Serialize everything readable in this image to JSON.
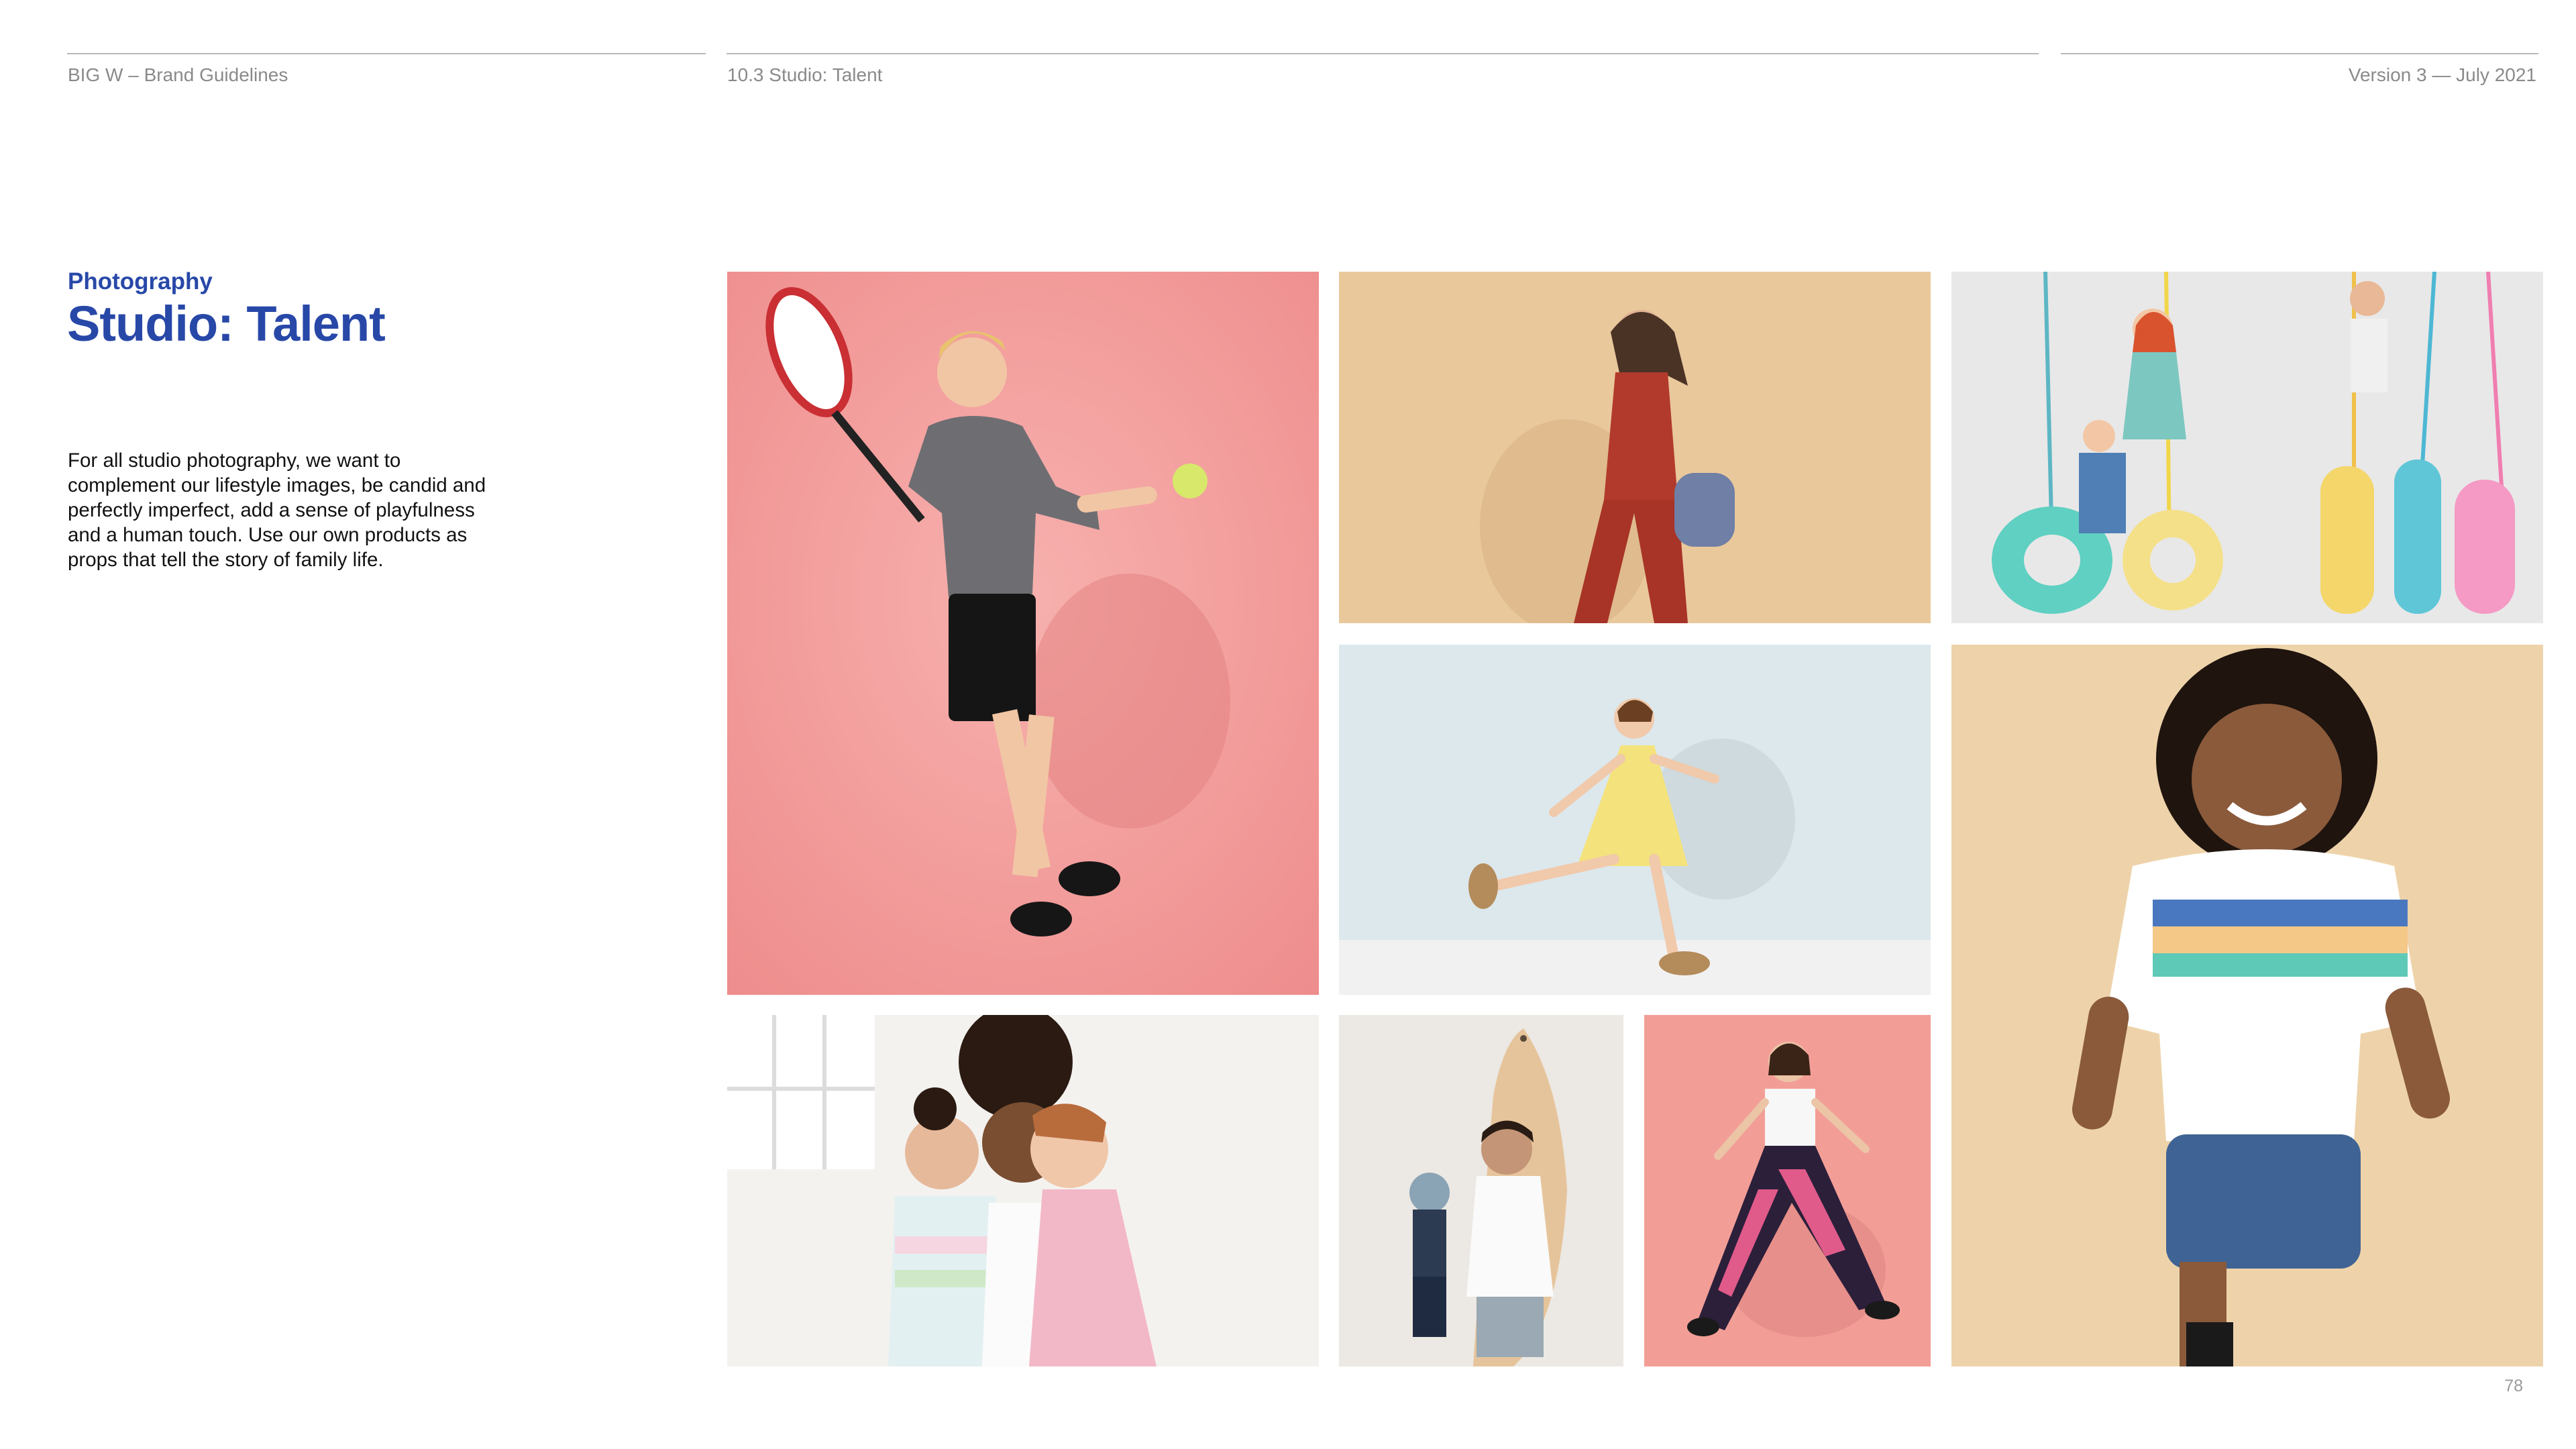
{
  "header": {
    "left": "BIG W – Brand Guidelines",
    "center": "10.3 Studio: Talent",
    "right": "Version 3 — July 2021"
  },
  "section": {
    "kicker": "Photography",
    "title": "Studio: Talent",
    "body": "For all studio photography, we want to complement our lifestyle images, be candid and perfectly imperfect, add a sense of playfulness and a human touch. Use our own products as props that tell the story of family life."
  },
  "page_number": "78",
  "photos": [
    {
      "subject": "boy-with-tennis-racket",
      "background": "#f2a0a0"
    },
    {
      "subject": "girl-with-backpack",
      "background": "#e8c79b"
    },
    {
      "subject": "girls-on-tyre-swings",
      "background": "#e9e9e9"
    },
    {
      "subject": "girl-running-yellow-dress",
      "background": "#d9e6eb"
    },
    {
      "subject": "boy-smiling-polo-shirt",
      "background": "#ecd1a8"
    },
    {
      "subject": "three-girls-hugging",
      "background": "#f3f1ee"
    },
    {
      "subject": "boys-with-surfboard",
      "background": "#ebe7e2"
    },
    {
      "subject": "girl-jumping-patterned-pants",
      "background": "#f19b96"
    }
  ],
  "colors": {
    "brand_blue": "#2848a8",
    "rule_grey": "#b9b9b9",
    "meta_grey": "#8a8a8a"
  }
}
